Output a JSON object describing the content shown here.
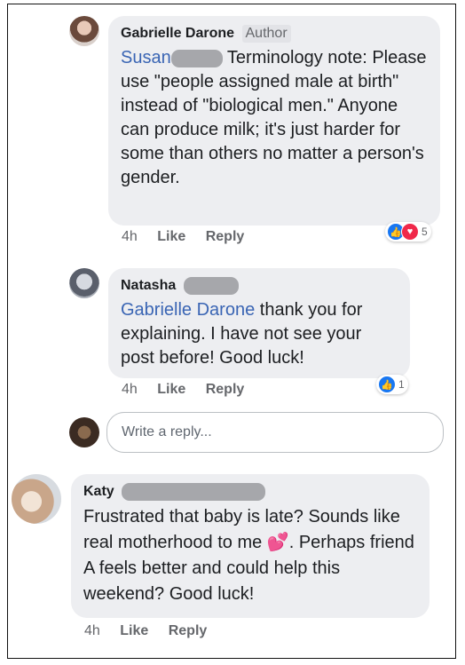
{
  "comments": [
    {
      "author": "Gabrielle Darone",
      "badge": "Author",
      "mention": "Susan",
      "text_after_mention": " Terminology note: Please use \"people assigned male at birth\" instead of \"biological men.\" Anyone can produce milk; it's just harder for some than others no matter a person's gender.",
      "time": "4h",
      "like": "Like",
      "reply": "Reply",
      "reaction_count": "5",
      "reaction_icons": [
        "like-icon",
        "love-icon"
      ]
    },
    {
      "author": "Natasha",
      "mention": "Gabrielle Darone",
      "text_after_mention": " thank you for explaining. I have not see your post before! Good luck!",
      "time": "4h",
      "like": "Like",
      "reply": "Reply",
      "reaction_count": "1",
      "reaction_icons": [
        "like-icon"
      ]
    },
    {
      "author": "Katy",
      "text": "Frustrated that baby is late? Sounds like real motherhood to me",
      "emoji": "💕",
      "text_after_emoji": ". Perhaps friend A feels better and could help this weekend? Good luck!",
      "time": "4h",
      "like": "Like",
      "reply": "Reply"
    }
  ],
  "reply_box": {
    "placeholder": "Write a reply..."
  },
  "colors": {
    "bubble": "#edeef1",
    "mention": "#3a65b4",
    "like_blue": "#1877f2",
    "love_red": "#f0284a"
  }
}
